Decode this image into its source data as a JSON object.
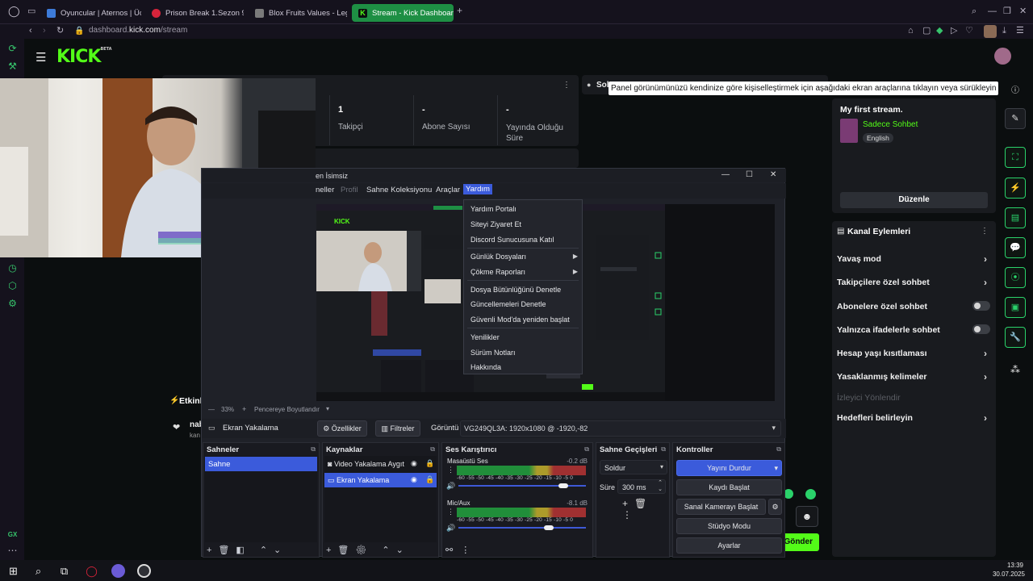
{
  "browser": {
    "tabs": [
      {
        "label": "Oyuncular | Aternos | Üc",
        "color": "#3d7bd9"
      },
      {
        "label": "Prison Break 1.Sezon 9.B",
        "color": "#d6243b"
      },
      {
        "label": "Blox Fruits Values - Leger",
        "color": "#7a7a7a"
      },
      {
        "label": "Stream - Kick Dashboard",
        "color": "#53fc18"
      }
    ],
    "new_tab": "+",
    "url_prefix": "dashboard.",
    "url_domain": "kick.com",
    "url_path": "/stream"
  },
  "kick": {
    "logo": "KICK",
    "logo_badge": "BETA",
    "stats": [
      {
        "value": "1",
        "label": "Takipçi"
      },
      {
        "value": "-",
        "label": "Abone Sayısı"
      },
      {
        "value": "-",
        "label": "Yayında Olduğu Süre"
      }
    ],
    "tooltip": "Panel görünümünüzü kendinize göre kişiselleştirmek için aşağıdaki ekran araçlarına tıklayın veya sürükleyin",
    "panel_header_fragment": "Sol",
    "stream_title": "My first stream.",
    "category": "Sadece Sohbet",
    "language": "English",
    "edit_button": "Düzenle",
    "channel_actions_title": "Kanal Eylemleri",
    "channel_actions": [
      {
        "label": "Yavaş mod",
        "type": "chevron"
      },
      {
        "label": "Takipçilere özel sohbet",
        "type": "chevron"
      },
      {
        "label": "Abonelere özel sohbet",
        "type": "toggle"
      },
      {
        "label": "Yalnızca ifadelerle sohbet",
        "type": "toggle"
      },
      {
        "label": "Hesap yaşı kısıtlaması",
        "type": "chevron"
      },
      {
        "label": "Yasaklanmış kelimeler",
        "type": "chevron"
      },
      {
        "label": "İzleyici Yönlendir",
        "type": "disabled"
      },
      {
        "label": "Hedefleri belirleyin",
        "type": "chevron"
      }
    ],
    "activity_fragment": "Etkinli",
    "activity_name_fragment": "nab",
    "activity_sub_fragment": "kan",
    "send_button": "Gönder",
    "sidebar_label": "GX"
  },
  "obs": {
    "title": "en İsimsiz",
    "menus": [
      "neller",
      "Profil",
      "Sahne Koleksiyonu",
      "Araçlar",
      "Yardım"
    ],
    "help_menu": [
      "Yardım Portalı",
      "Siteyi Ziyaret Et",
      "Discord Sunucusuna Katıl",
      "Günlük Dosyaları",
      "Çökme Raporları",
      "Dosya Bütünlüğünü Denetle",
      "Güncellemeleri Denetle",
      "Güvenli Mod'da yeniden başlat",
      "Yenilikler",
      "Sürüm Notları",
      "Hakkında"
    ],
    "zoom": "33%",
    "fit_label": "Pencereye Boyutlandır",
    "source_name": "Ekran Yakalama",
    "properties_btn": "Özellikler",
    "filters_btn": "Filtreler",
    "display_label": "Görüntü",
    "display_value": "VG249QL3A: 1920x1080 @ -1920,-82",
    "docks": {
      "scenes": "Sahneler",
      "sources": "Kaynaklar",
      "mixer": "Ses Karıştırıcı",
      "transitions": "Sahne Geçişleri",
      "controls": "Kontroller"
    },
    "scenes": [
      "Sahne"
    ],
    "sources": [
      "Video Yakalama Aygıt",
      "Ekran Yakalama"
    ],
    "mixer": [
      {
        "name": "Masaüstü Ses",
        "db": "-0.2 dB",
        "level": 0.82
      },
      {
        "name": "Mic/Aux",
        "db": "-8.1 dB",
        "level": 0.71
      }
    ],
    "meter_scale": "-60 -55 -50 -45 -40 -35 -30 -25 -20 -15 -10 -5 0",
    "transition": "Soldur",
    "duration_label": "Süre",
    "duration_value": "300 ms",
    "controls": [
      "Yayını Durdur",
      "Kaydı Başlat",
      "Sanal Kamerayı Başlat",
      "Stüdyo Modu",
      "Ayarlar"
    ]
  },
  "taskbar": {
    "time": "13:39",
    "date": "30.07.2025"
  }
}
